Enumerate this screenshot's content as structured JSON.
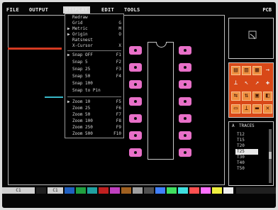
{
  "menu": {
    "file": "FILE",
    "output": "OUTPUT",
    "display": "DISPLAY",
    "edit": "EDIT",
    "tools": "TOOLS"
  },
  "pcb_label": "PCB",
  "display_menu": [
    {
      "marker": "",
      "label": "Redraw",
      "key": ""
    },
    {
      "marker": "",
      "label": "Grid",
      "key": "G"
    },
    {
      "marker": "▶",
      "label": "Metric",
      "key": "M"
    },
    {
      "marker": "▶",
      "label": "Origin",
      "key": "O"
    },
    {
      "marker": "",
      "label": "Ratsnest",
      "key": ""
    },
    {
      "marker": "",
      "label": "X-Cursor",
      "key": "X"
    },
    {
      "marker": "▶",
      "label": "Snap  OFF",
      "key": "F1"
    },
    {
      "marker": "",
      "label": "Snap   5",
      "key": "F2"
    },
    {
      "marker": "",
      "label": "Snap  25",
      "key": "F3"
    },
    {
      "marker": "",
      "label": "Snap  50",
      "key": "F4"
    },
    {
      "marker": "",
      "label": "Snap 100",
      "key": ""
    },
    {
      "marker": "",
      "label": "Snap to Pin",
      "key": ""
    },
    {
      "marker": "▶",
      "label": "Zoom  10",
      "key": "F5"
    },
    {
      "marker": "",
      "label": "Zoom  25",
      "key": "F6"
    },
    {
      "marker": "",
      "label": "Zoom  50",
      "key": "F7"
    },
    {
      "marker": "",
      "label": "Zoom 100",
      "key": "F8"
    },
    {
      "marker": "",
      "label": "Zoom 250",
      "key": "F9"
    },
    {
      "marker": "",
      "label": "Zoom 500",
      "key": "F10"
    }
  ],
  "traces": {
    "marker": "A",
    "title": "TRACES",
    "items": [
      "T12",
      "T15",
      "T20",
      "T25",
      "T30",
      "T40",
      "T50"
    ],
    "selected": "T25"
  },
  "status": {
    "left": "C1",
    "mid": "C1"
  },
  "colors": {
    "pad": "#e870c8",
    "accent": "#d84818",
    "menu_highlight": "#d8d8d8"
  }
}
